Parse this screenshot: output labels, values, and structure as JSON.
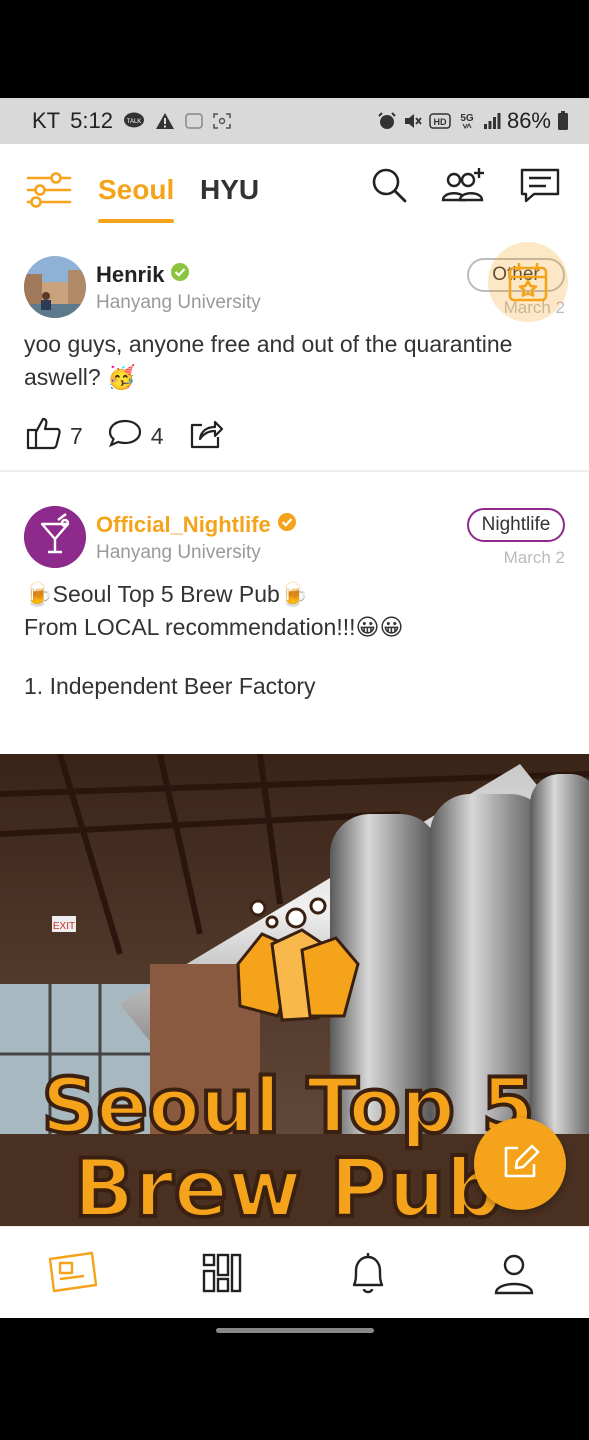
{
  "status_bar": {
    "carrier": "KT",
    "time": "5:12",
    "battery": "86%",
    "icons": [
      "talk-icon",
      "warning-icon",
      "nfc-icon",
      "screenshot-icon",
      "alarm-icon",
      "mute-icon",
      "hd-icon",
      "5g-icon",
      "signal-icon",
      "battery-icon"
    ]
  },
  "header": {
    "tabs": [
      {
        "label": "Seoul",
        "active": true
      },
      {
        "label": "HYU",
        "active": false
      }
    ],
    "icons": [
      "filter-icon",
      "search-icon",
      "add-friend-icon",
      "messages-icon"
    ]
  },
  "posts": [
    {
      "author": "Henrik",
      "verified": true,
      "university": "Hanyang University",
      "category": "Other",
      "date": "March 2",
      "text": "yoo guys, anyone free and out of the quarantine aswell? 🥳",
      "likes": "7",
      "comments": "4"
    },
    {
      "author": "Official_Nightlife",
      "verified": true,
      "university": "Hanyang University",
      "category": "Nightlife",
      "date": "March 2",
      "text_line1": "🍺Seoul Top 5 Brew Pub🍺",
      "text_line2": "From LOCAL recommendation!!!😀😀",
      "text_line3": "1. Independent Beer Factory",
      "image_title_line1": "Seoul Top 5",
      "image_title_line2": "Brew Pub",
      "image_sign": "EXIT"
    }
  ],
  "bottom_nav": {
    "items": [
      "feed-icon",
      "boards-icon",
      "bell-icon",
      "profile-icon"
    ],
    "active": "feed-icon"
  },
  "colors": {
    "accent": "#f5a31a",
    "nightlife": "#8e2a8c",
    "verified_green": "#8bc53f"
  }
}
